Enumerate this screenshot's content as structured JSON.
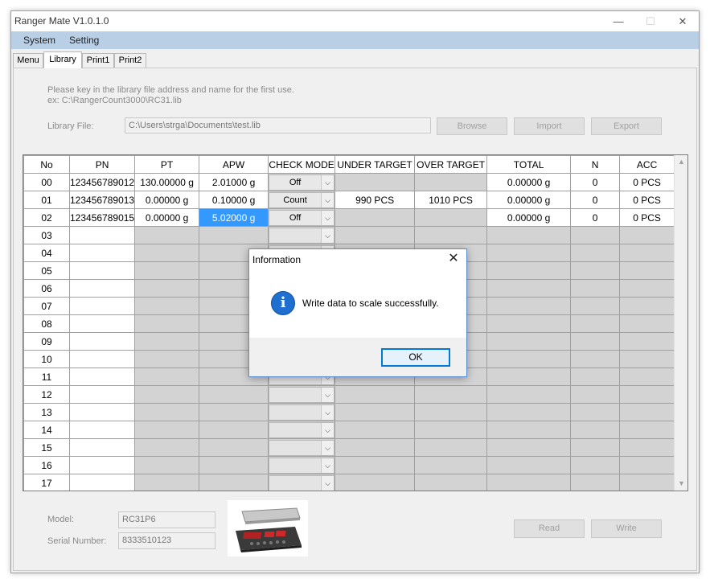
{
  "window": {
    "title": "Ranger Mate   V1.0.1.0",
    "minimize": "—",
    "maximize": "☐",
    "close": "✕"
  },
  "menu": [
    "System",
    "Setting"
  ],
  "tabs": [
    "Menu",
    "Library",
    "Print1",
    "Print2"
  ],
  "library": {
    "hint_line1": "Please key in the library file address and name for the first use.",
    "hint_line2": "ex: C:\\RangerCount3000\\RC31.lib",
    "file_label": "Library File:",
    "file_value": "C:\\Users\\strga\\Documents\\test.lib",
    "browse": "Browse",
    "import": "Import",
    "export": "Export"
  },
  "grid": {
    "columns": [
      "No",
      "PN",
      "PT",
      "APW",
      "CHECK MODE",
      "UNDER TARGET",
      "OVER TARGET",
      "TOTAL",
      "N",
      "ACC"
    ],
    "rows": [
      {
        "no": "00",
        "pn": "123456789012",
        "pt": "130.00000 g",
        "apw": "2.01000 g",
        "mode": "Off",
        "under": "",
        "over": "",
        "total": "0.00000 g",
        "n": "0",
        "acc": "0 PCS"
      },
      {
        "no": "01",
        "pn": "123456789013",
        "pt": "0.00000 g",
        "apw": "0.10000 g",
        "mode": "Count",
        "under": "990 PCS",
        "over": "1010 PCS",
        "total": "0.00000 g",
        "n": "0",
        "acc": "0 PCS"
      },
      {
        "no": "02",
        "pn": "123456789015",
        "pt": "0.00000 g",
        "apw": "5.02000 g",
        "mode": "Off",
        "under": "",
        "over": "",
        "total": "0.00000 g",
        "n": "0",
        "acc": "0 PCS"
      }
    ],
    "empty_rows": [
      "03",
      "04",
      "05",
      "06",
      "07",
      "08",
      "09",
      "10",
      "11",
      "12",
      "13",
      "14",
      "15",
      "16",
      "17"
    ]
  },
  "device": {
    "model_label": "Model:",
    "model_value": "RC31P6",
    "serial_label": "Serial Number:",
    "serial_value": "8333510123",
    "read": "Read",
    "write": "Write"
  },
  "dialog": {
    "title": "Information",
    "message": "Write data to scale successfully.",
    "ok": "OK",
    "close": "✕",
    "icon": "i"
  },
  "icons": {
    "dropdown": "chevron-down-icon",
    "info": "info-icon"
  },
  "colors": {
    "menubar": "#b8cfe6",
    "selected_cell": "#3399ff",
    "dialog_border": "#5b8fd1",
    "info_icon": "#1f6fd0"
  }
}
